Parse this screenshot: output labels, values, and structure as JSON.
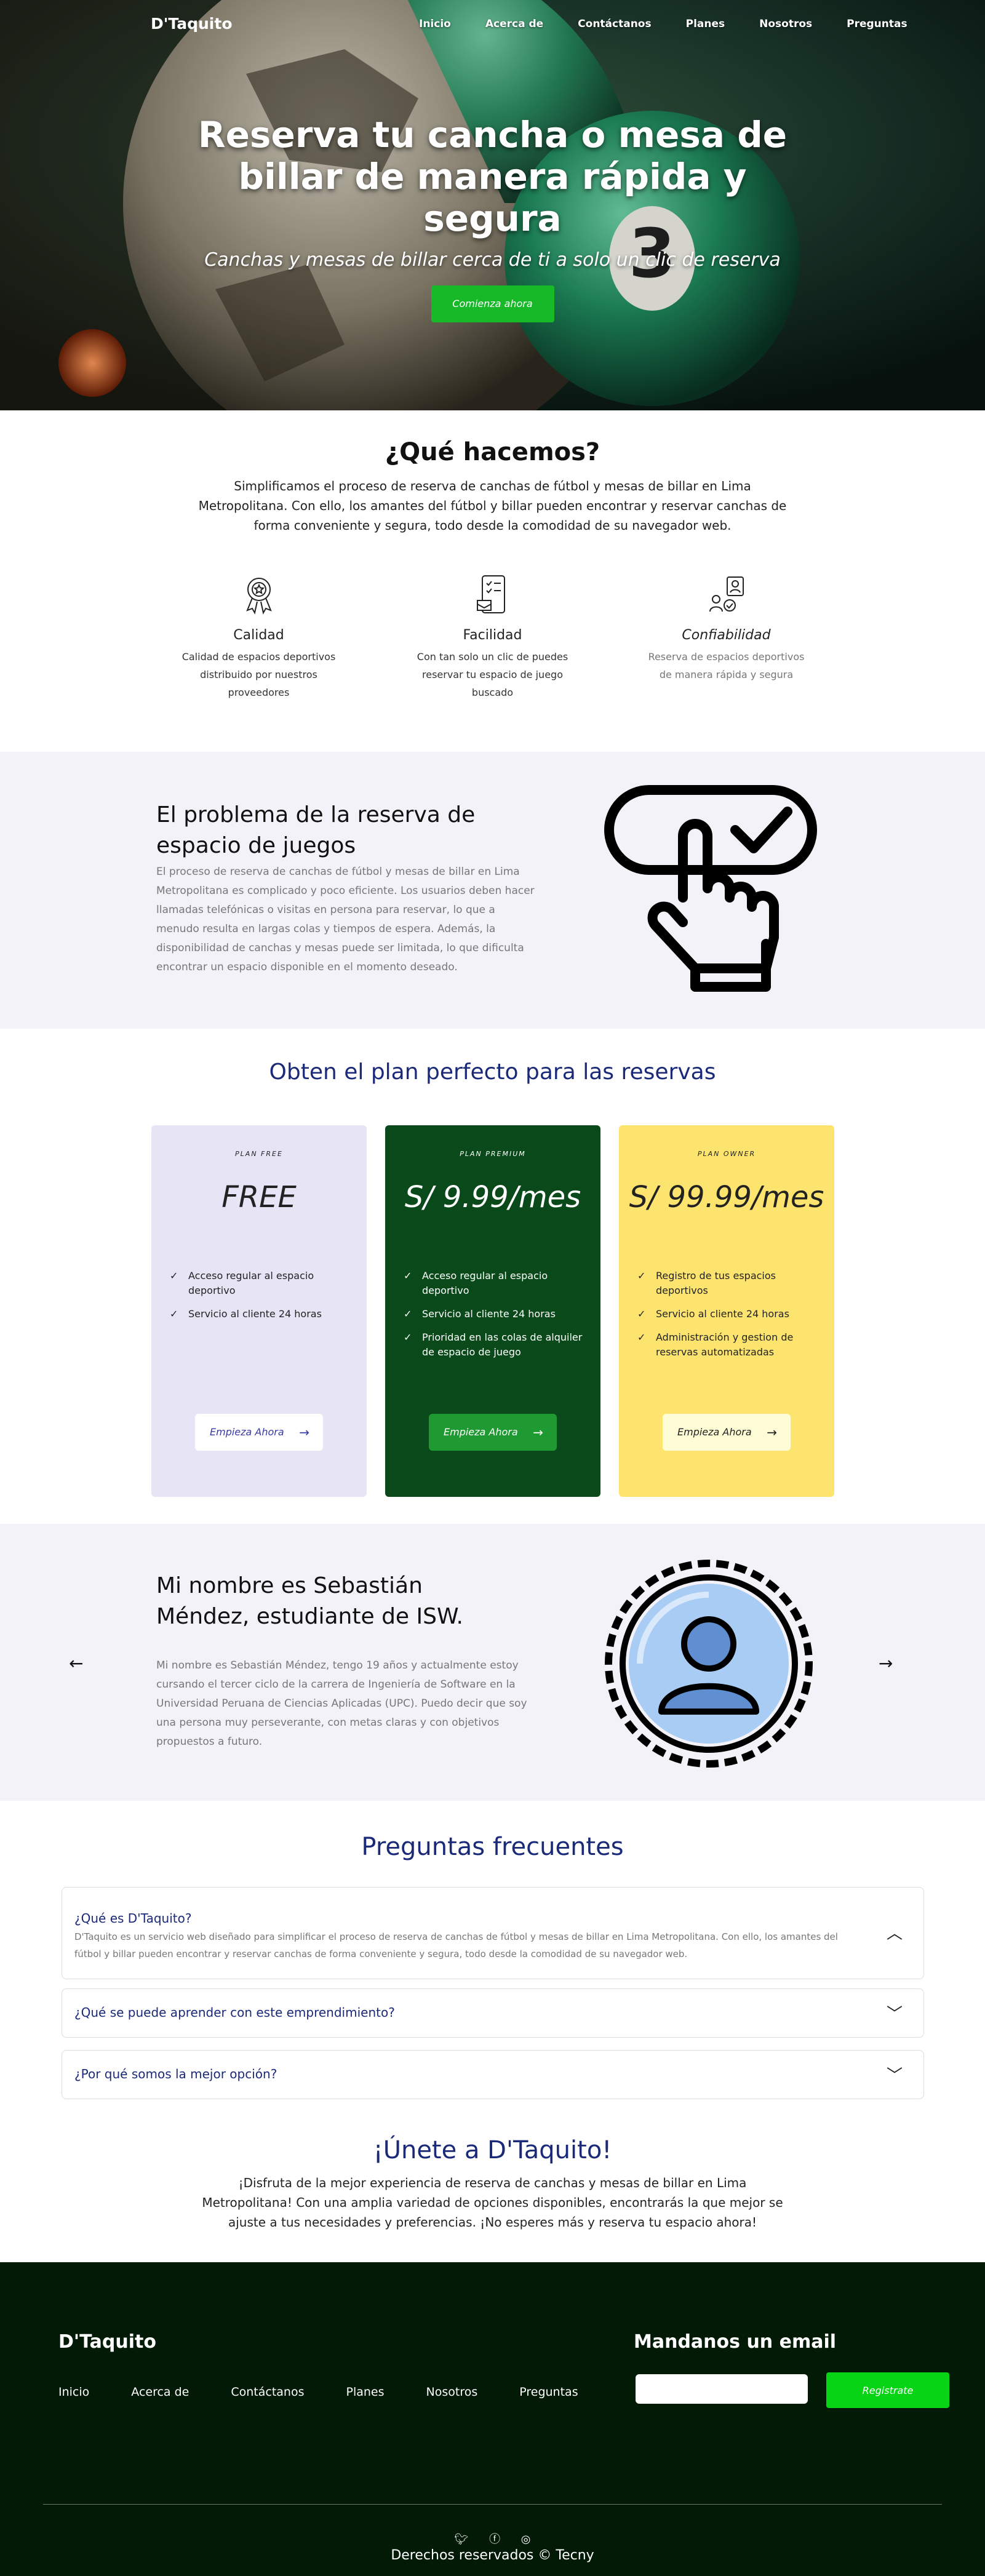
{
  "nav": {
    "brand": "D'Taquito",
    "items": [
      "Inicio",
      "Acerca de",
      "Contáctanos",
      "Planes",
      "Nosotros",
      "Preguntas"
    ]
  },
  "hero": {
    "title": "Reserva tu cancha o mesa de billar de manera rápida y segura",
    "subtitle": "Canchas  y mesas de billar cerca de ti a solo un clic de reserva",
    "cta": "Comienza ahora"
  },
  "what": {
    "title": "¿Qué hacemos?",
    "text": "Simplificamos el proceso de reserva de canchas de fútbol y mesas de billar en Lima Metropolitana. Con ello, los amantes del fútbol y billar pueden encontrar y reservar canchas de forma conveniente y segura, todo desde la comodidad de su navegador web.",
    "features": [
      {
        "title": "Calidad",
        "text": "Calidad de espacios deportivos distribuido por nuestros proveedores",
        "icon": "award-medal-icon"
      },
      {
        "title": "Facilidad",
        "text": "Con tan solo un clic de puedes reservar tu espacio de juego buscado",
        "icon": "checklist-phone-icon"
      },
      {
        "title": "Confiabilidad",
        "text": "Reserva de espacios deportivos de manera rápida y segura",
        "icon": "trusted-user-icon"
      }
    ]
  },
  "problem": {
    "title": "El problema de la reserva de espacio de juegos",
    "text": "El proceso de reserva de canchas de fútbol y mesas de billar en Lima Metropolitana es complicado y poco eficiente. Los usuarios deben hacer llamadas telefónicas o visitas en persona para reservar, lo que a menudo resulta en largas colas y tiempos de espera. Además, la disponibilidad de canchas y mesas puede ser limitada, lo que dificulta encontrar un espacio disponible en el momento deseado."
  },
  "plans": {
    "title": "Obten el plan perfecto para las reservas",
    "items": [
      {
        "label": "PLAN FREE",
        "price": "FREE",
        "features": [
          "Acceso regular al espacio deportivo",
          "Servicio al cliente 24 horas"
        ],
        "button": "Empieza Ahora"
      },
      {
        "label": "PLAN PREMIUM",
        "price": "S/ 9.99/mes",
        "features": [
          "Acceso regular al espacio deportivo",
          "Servicio al cliente 24 horas",
          "Prioridad en las colas de alquiler de espacio de juego"
        ],
        "button": "Empieza Ahora"
      },
      {
        "label": "PLAN OWNER",
        "price": "S/ 99.99/mes",
        "features": [
          "Registro de tus espacios deportivos",
          "Servicio al cliente 24 horas",
          "Administración y gestion de reservas automatizadas"
        ],
        "button": "Empieza Ahora"
      }
    ]
  },
  "profile": {
    "title": "Mi nombre es Sebastián Méndez, estudiante de ISW.",
    "text": "Mi nombre es Sebastián Méndez, tengo 19 años y actualmente estoy cursando el tercer ciclo de la carrera de Ingeniería de Software en la Universidad Peruana de Ciencias Aplicadas (UPC). Puedo decir que soy una persona muy perseverante, con metas claras y con objetivos propuestos a futuro."
  },
  "faq": {
    "title": "Preguntas frecuentes",
    "items": [
      {
        "q": "¿Qué es D'Taquito?",
        "a": "D'Taquito es un servicio web diseñado para simplificar el proceso de reserva de canchas de fútbol y mesas de billar en Lima Metropolitana. Con ello, los amantes del fútbol y billar pueden encontrar y reservar canchas de forma conveniente y segura, todo desde la comodidad de su navegador web."
      },
      {
        "q": "¿Qué se puede aprender con este emprendimiento?"
      },
      {
        "q": "¿Por qué somos la mejor opción?"
      }
    ]
  },
  "join": {
    "title": "¡Únete a D'Taquito!",
    "text": "¡Disfruta de la mejor experiencia de reserva de canchas y mesas de billar en Lima Metropolitana! Con una amplia variedad de opciones disponibles, encontrarás la que mejor se ajuste a tus necesidades y preferencias. ¡No esperes más y reserva tu espacio ahora!"
  },
  "footer": {
    "brand": "D'Taquito",
    "links": [
      "Inicio",
      "Acerca de",
      "Contáctanos",
      "Planes",
      "Nosotros",
      "Preguntas"
    ],
    "email_title": "Mandanos un email",
    "email_button": "Registrate",
    "social": [
      "twitter-icon",
      "facebook-icon",
      "instagram-icon"
    ],
    "copyright": "Derechos reservados © Tecny"
  },
  "colors": {
    "accent_green": "#18b928",
    "navy_heading": "#1b2a78",
    "footer_bg": "#031a06",
    "section_bg": "#f3f2f9",
    "plan_free_bg": "#e6e4f5",
    "plan_premium_bg": "#0a4a1a",
    "plan_owner_bg": "#fde46f"
  }
}
